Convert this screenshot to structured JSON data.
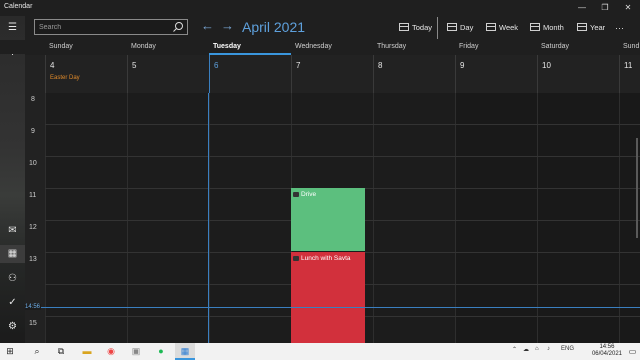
{
  "window": {
    "title": "Calendar",
    "minimize": "—",
    "maximize": "❐",
    "close": "✕"
  },
  "search": {
    "placeholder": "Search"
  },
  "header": {
    "month": "April 2021",
    "prev": "←",
    "next": "→"
  },
  "toolbar": {
    "today": "Today",
    "day": "Day",
    "week": "Week",
    "month": "Month",
    "year": "Year",
    "more": "···"
  },
  "days": [
    {
      "name": "Sunday",
      "date": "4",
      "holiday": "Easter Day"
    },
    {
      "name": "Monday",
      "date": "5"
    },
    {
      "name": "Tuesday",
      "date": "6",
      "today": true
    },
    {
      "name": "Wednesday",
      "date": "7"
    },
    {
      "name": "Thursday",
      "date": "8"
    },
    {
      "name": "Friday",
      "date": "9"
    },
    {
      "name": "Saturday",
      "date": "10"
    },
    {
      "name": "Sund",
      "date": "11"
    }
  ],
  "hours": [
    "8",
    "9",
    "10",
    "11",
    "12",
    "13",
    "14",
    "15"
  ],
  "now": "14:56",
  "events": [
    {
      "title": "Drive",
      "color": "#5cbf7e"
    },
    {
      "title": "Lunch with Savta",
      "color": "#d2303c"
    }
  ],
  "taskbar": {
    "lang": "ENG",
    "time": "14:56",
    "date": "06/04/2021"
  }
}
